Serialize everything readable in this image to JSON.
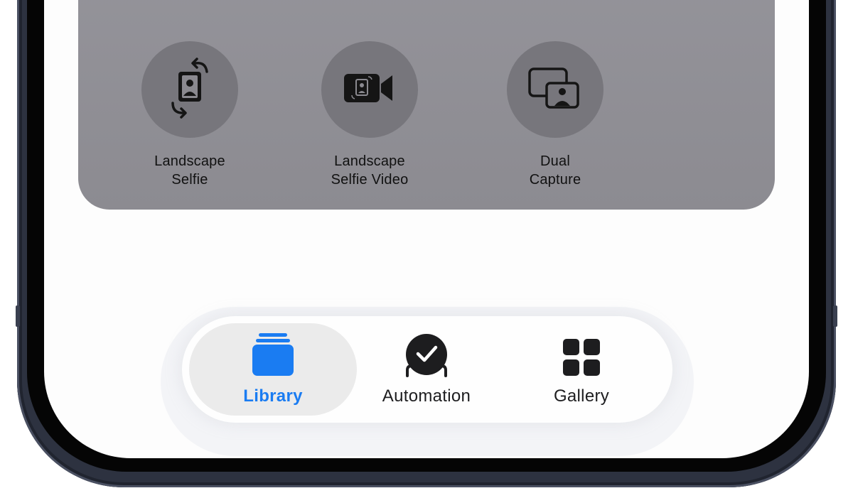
{
  "shortcuts": [
    {
      "line1": "Landscape",
      "line2": "Selfie",
      "icon": "rotate-portrait-icon"
    },
    {
      "line1": "Landscape",
      "line2": "Selfie Video",
      "icon": "video-selfie-icon"
    },
    {
      "line1": "Dual",
      "line2": "Capture",
      "icon": "dual-capture-icon"
    }
  ],
  "tabs": [
    {
      "label": "Library",
      "icon": "library-stack-icon",
      "active": true
    },
    {
      "label": "Automation",
      "icon": "automation-check-icon",
      "active": false
    },
    {
      "label": "Gallery",
      "icon": "gallery-grid-icon",
      "active": false
    }
  ],
  "colors": {
    "accent": "#1a7cf2",
    "card_background": "#8f8e94",
    "icon_circle": "#77767c",
    "frame": "#2d3240"
  }
}
